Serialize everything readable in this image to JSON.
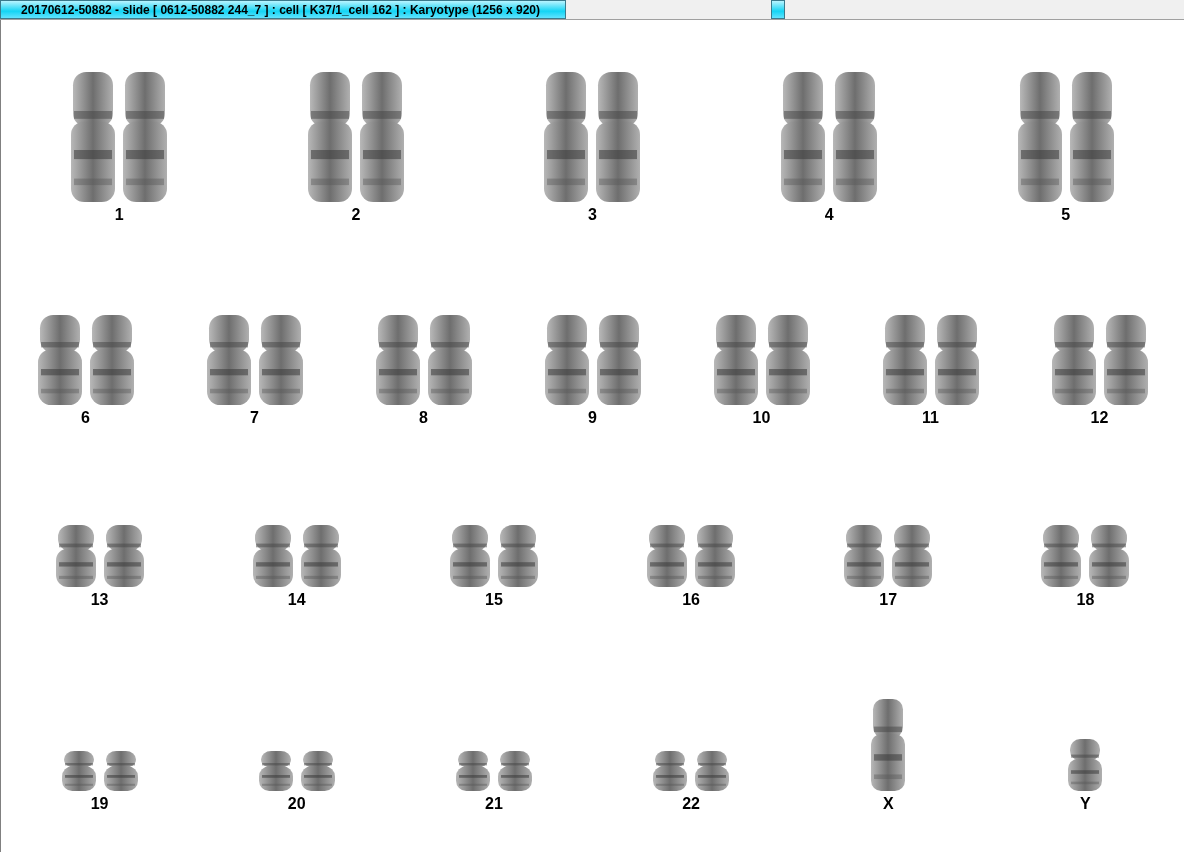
{
  "window": {
    "title": "20170612-50882 - slide [ 0612-50882 244_7 ] : cell [ K37/1_cell 162 ] : Karyotype  (1256 x 920)"
  },
  "karyotype": {
    "rows": [
      {
        "chromosomes": [
          {
            "label": "1",
            "kind": "pair"
          },
          {
            "label": "2",
            "kind": "pair"
          },
          {
            "label": "3",
            "kind": "pair"
          },
          {
            "label": "4",
            "kind": "pair"
          },
          {
            "label": "5",
            "kind": "pair"
          }
        ]
      },
      {
        "chromosomes": [
          {
            "label": "6",
            "kind": "pair"
          },
          {
            "label": "7",
            "kind": "pair"
          },
          {
            "label": "8",
            "kind": "pair"
          },
          {
            "label": "9",
            "kind": "pair"
          },
          {
            "label": "10",
            "kind": "pair"
          },
          {
            "label": "11",
            "kind": "pair"
          },
          {
            "label": "12",
            "kind": "pair"
          }
        ]
      },
      {
        "chromosomes": [
          {
            "label": "13",
            "kind": "pair"
          },
          {
            "label": "14",
            "kind": "pair"
          },
          {
            "label": "15",
            "kind": "pair"
          },
          {
            "label": "16",
            "kind": "pair"
          },
          {
            "label": "17",
            "kind": "pair"
          },
          {
            "label": "18",
            "kind": "pair"
          }
        ]
      },
      {
        "chromosomes": [
          {
            "label": "19",
            "kind": "pair"
          },
          {
            "label": "20",
            "kind": "pair"
          },
          {
            "label": "21",
            "kind": "pair"
          },
          {
            "label": "22",
            "kind": "pair"
          },
          {
            "label": "X",
            "kind": "single"
          },
          {
            "label": "Y",
            "kind": "single"
          }
        ]
      }
    ]
  }
}
